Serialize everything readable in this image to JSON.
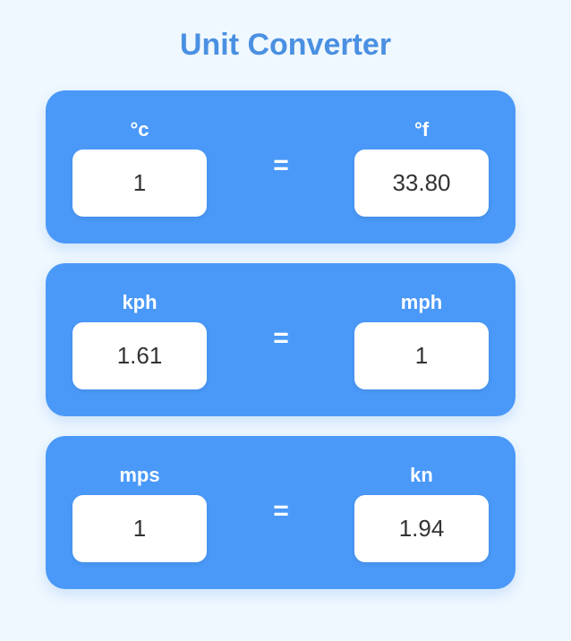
{
  "app": {
    "title": "Unit Converter"
  },
  "converters": [
    {
      "left_unit": "°c",
      "left_value": "1",
      "equals": "=",
      "right_unit": "°f",
      "right_value": "33.80"
    },
    {
      "left_unit": "kph",
      "left_value": "1.61",
      "equals": "=",
      "right_unit": "mph",
      "right_value": "1"
    },
    {
      "left_unit": "mps",
      "left_value": "1",
      "equals": "=",
      "right_unit": "kn",
      "right_value": "1.94"
    }
  ],
  "colors": {
    "background": "#f0f8ff",
    "accent": "#4a90e2",
    "card": "#4a99f8",
    "text_on_card": "#ffffff",
    "input_text": "#333333"
  }
}
